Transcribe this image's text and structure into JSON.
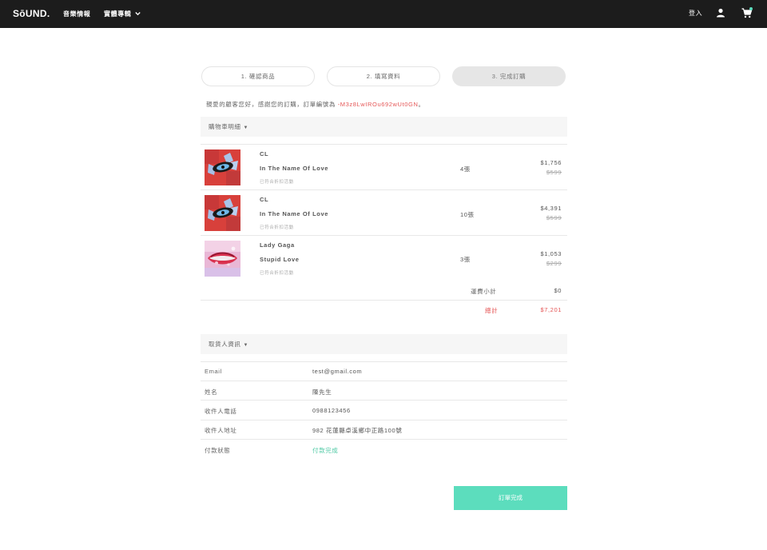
{
  "nav": {
    "logo": "SōUND.",
    "links": [
      "音樂情報",
      "實體專輯"
    ],
    "login": "登入"
  },
  "steps": [
    "1. 確認商品",
    "2. 填寫資料",
    "3. 完成訂購"
  ],
  "thanks": {
    "text": "親愛的顧客您好，感謝您的訂購，訂單編號為 ",
    "order_id": "-M3z8LwIROu692wUt0GN",
    "suffix": "。"
  },
  "cart": {
    "header": "購物車明細",
    "items": [
      {
        "artist": "CL",
        "album": "In The Name Of Love",
        "note": "已符合折扣活動",
        "qty": "4張",
        "price": "$1,756",
        "old_price": "$599"
      },
      {
        "artist": "CL",
        "album": "In The Name Of Love",
        "note": "已符合折扣活動",
        "qty": "10張",
        "price": "$4,391",
        "old_price": "$599"
      },
      {
        "artist": "Lady Gaga",
        "album": "Stupid Love",
        "note": "已符合折扣活動",
        "qty": "3張",
        "price": "$1,053",
        "old_price": "$299"
      }
    ],
    "shipping_label": "運費小計",
    "shipping_value": "$0",
    "total_label": "總計",
    "total_value": "$7,201"
  },
  "recipient": {
    "header": "取貨人資訊",
    "rows": [
      {
        "label": "Email",
        "value": "test@gmail.com"
      },
      {
        "label": "姓名",
        "value": "陳先生"
      },
      {
        "label": "收件人電話",
        "value": "0988123456"
      },
      {
        "label": "收件人地址",
        "value": "982 花蓮縣卓溪鄉中正路100號"
      },
      {
        "label": "付款狀態",
        "value": "付款完成"
      }
    ]
  },
  "done_button": "訂單完成",
  "colors": {
    "accent": "#5cddbd",
    "alert": "#e55656",
    "nav_bg": "#1c1c1c",
    "paid": "#4fc9a4"
  }
}
